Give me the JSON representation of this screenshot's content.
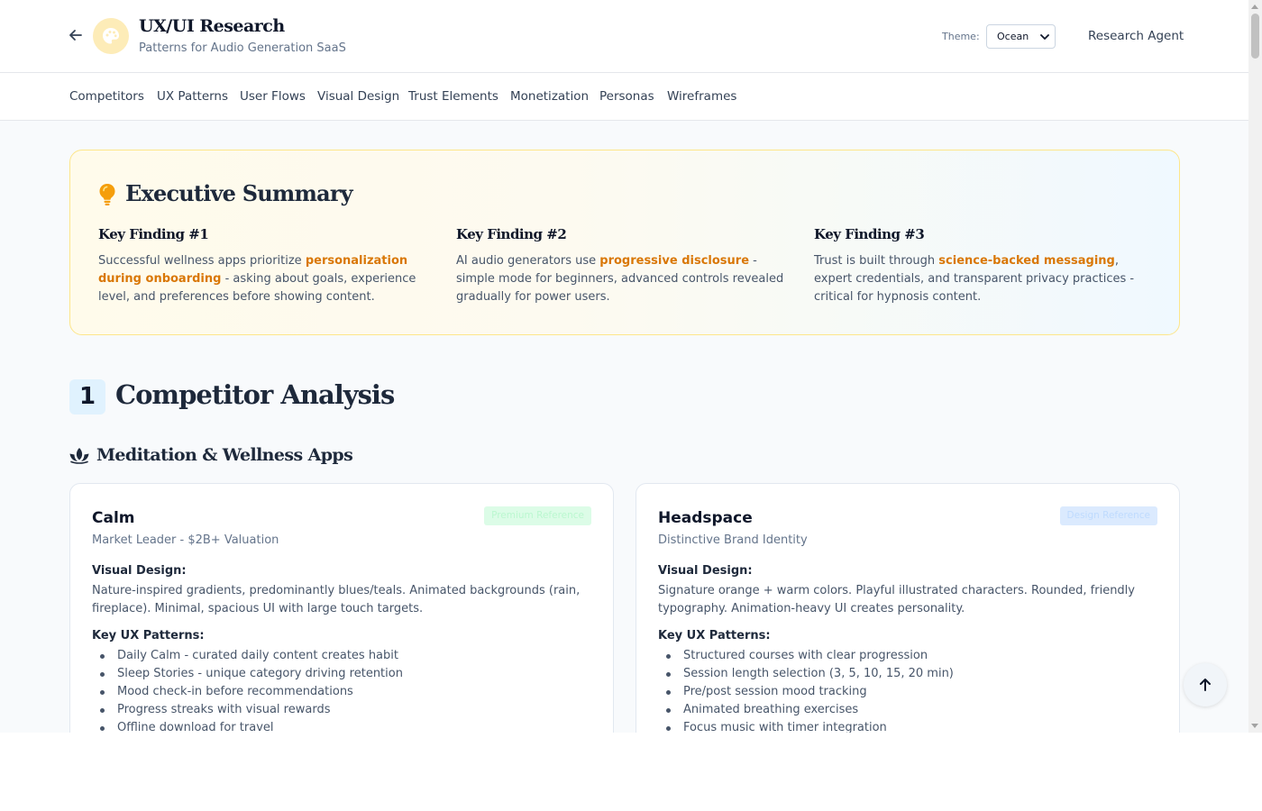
{
  "header": {
    "back_icon": "arrow-left-icon",
    "logo_icon": "palette-icon",
    "title": "UX/UI Research",
    "subtitle": "Patterns for Audio Generation SaaS",
    "theme_label": "Theme:",
    "theme_value": "Ocean",
    "agent_link": "Research Agent"
  },
  "nav": {
    "items": [
      "Competitors",
      "UX Patterns",
      "User Flows",
      "Visual Design",
      "Trust Elements",
      "Monetization",
      "Personas",
      "Wireframes"
    ]
  },
  "executive_summary": {
    "icon": "lightbulb-icon",
    "title": "Executive Summary",
    "findings": [
      {
        "title": "Key Finding #1",
        "pre": "Successful wellness apps prioritize ",
        "highlight": "personalization during onboarding",
        "post": " - asking about goals, experience level, and preferences before showing content."
      },
      {
        "title": "Key Finding #2",
        "pre": "AI audio generators use ",
        "highlight": "progressive disclosure",
        "post": " - simple mode for beginners, advanced controls revealed gradually for power users."
      },
      {
        "title": "Key Finding #3",
        "pre": "Trust is built through ",
        "highlight": "science-backed messaging",
        "post": ", expert credentials, and transparent privacy practices - critical for hypnosis content."
      }
    ]
  },
  "section": {
    "number": "1",
    "title": "Competitor Analysis",
    "subsection_icon": "lotus-icon",
    "subsection_title": "Meditation & Wellness Apps"
  },
  "cards": [
    {
      "name": "Calm",
      "badge": "Premium Reference",
      "tagline": "Market Leader - $2B+ Valuation",
      "visual_label": "Visual Design:",
      "visual_text": "Nature-inspired gradients, predominantly blues/teals. Animated backgrounds (rain, fireplace). Minimal, spacious UI with large touch targets.",
      "patterns_label": "Key UX Patterns:",
      "patterns": [
        "Daily Calm - curated daily content creates habit",
        "Sleep Stories - unique category driving retention",
        "Mood check-in before recommendations",
        "Progress streaks with visual rewards",
        "Offline download for travel"
      ]
    },
    {
      "name": "Headspace",
      "badge": "Design Reference",
      "tagline": "Distinctive Brand Identity",
      "visual_label": "Visual Design:",
      "visual_text": "Signature orange + warm colors. Playful illustrated characters. Rounded, friendly typography. Animation-heavy UI creates personality.",
      "patterns_label": "Key UX Patterns:",
      "patterns": [
        "Structured courses with clear progression",
        "Session length selection (3, 5, 10, 15, 20 min)",
        "Pre/post session mood tracking",
        "Animated breathing exercises",
        "Focus music with timer integration"
      ]
    }
  ],
  "scroll_top_icon": "arrow-up-icon"
}
